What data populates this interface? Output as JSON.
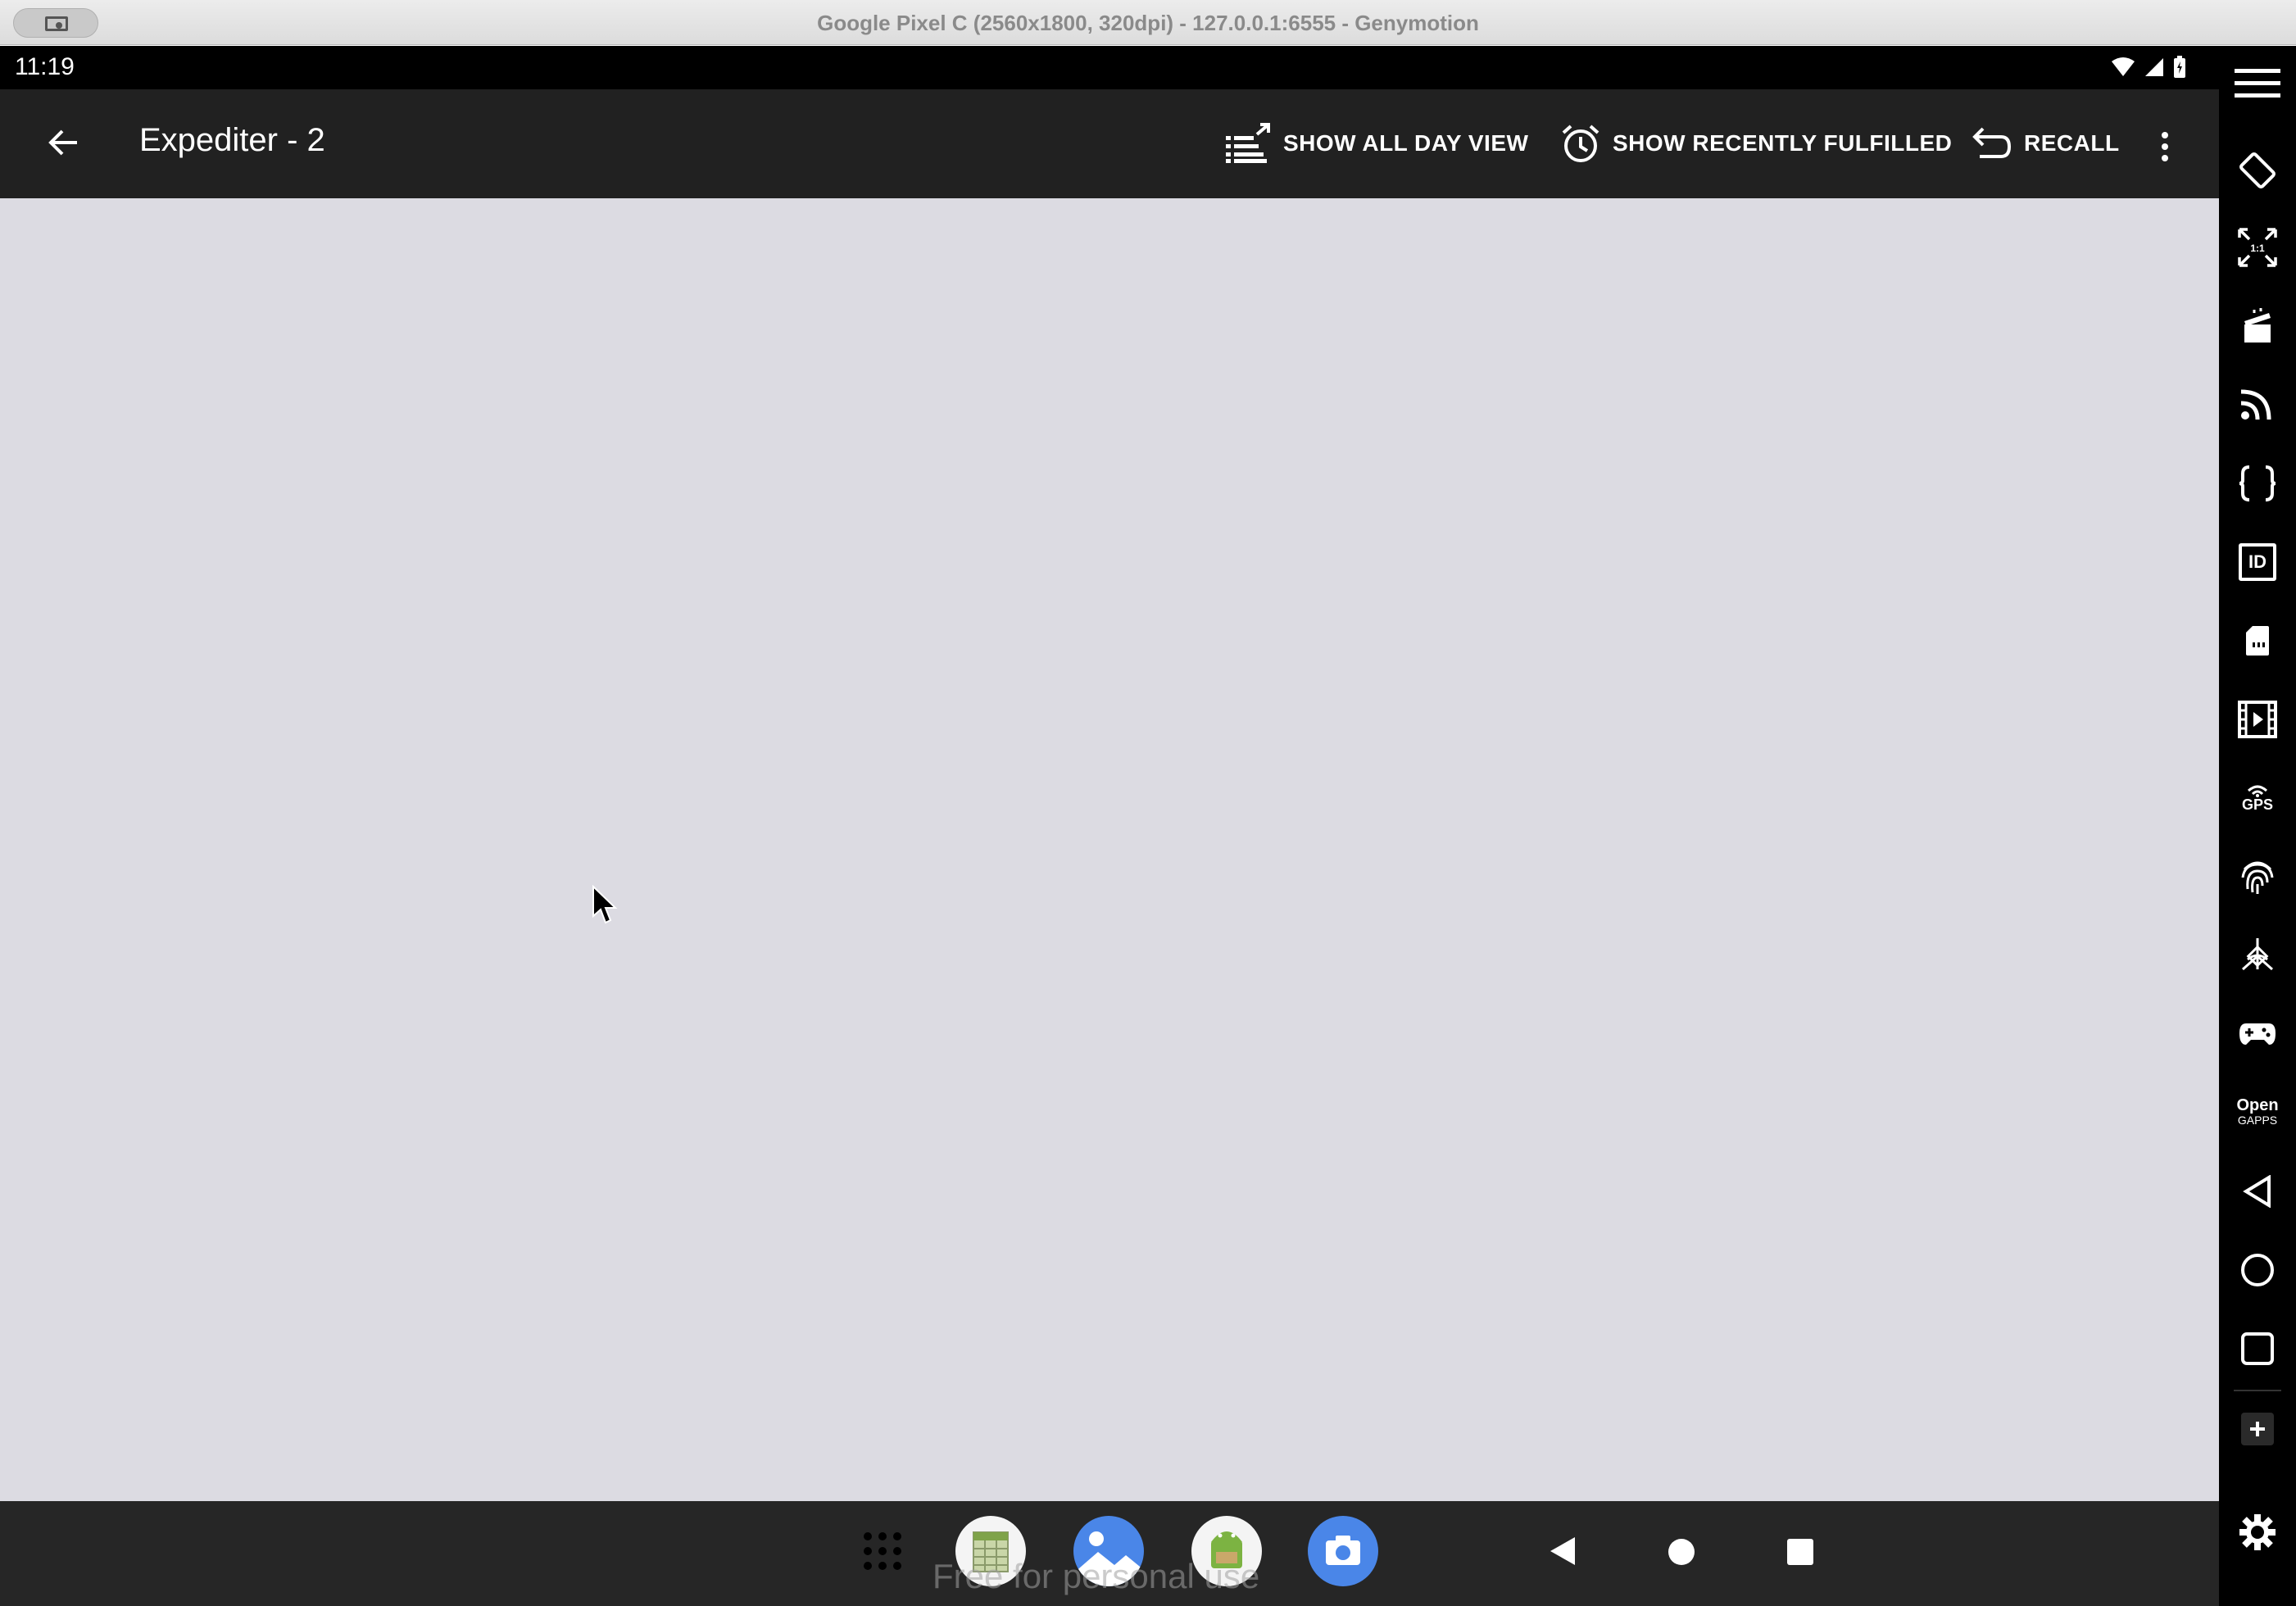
{
  "window": {
    "title": "Google Pixel C (2560x1800, 320dpi) - 127.0.0.1:6555 - Genymotion"
  },
  "status_bar": {
    "time": "11:19",
    "icons": [
      "wifi-icon",
      "signal-icon",
      "battery-icon"
    ]
  },
  "app_bar": {
    "title": "Expediter - 2",
    "actions": [
      {
        "label": "SHOW ALL DAY VIEW",
        "icon": "list-expand-icon"
      },
      {
        "label": "SHOW RECENTLY FULFILLED",
        "icon": "alarm-clock-icon"
      },
      {
        "label": "RECALL",
        "icon": "undo-arrow-icon"
      }
    ],
    "overflow_icon": "more-vert-icon"
  },
  "nav_bar": {
    "watermark": "Free for personal use",
    "dock_apps": [
      "app-drawer-icon",
      "spreadsheet-app-icon",
      "gallery-app-icon",
      "android-app-icon",
      "camera-app-icon"
    ],
    "buttons": [
      "back-icon",
      "home-icon",
      "recents-icon"
    ]
  },
  "toolbar": {
    "items": [
      "menu-icon",
      "rotate-icon",
      "pixel-perfect-icon",
      "capture-icon",
      "cast-icon",
      "api-icon",
      "identifiers-icon",
      "sd-card-icon",
      "media-icon",
      "gps-icon",
      "biometrics-icon",
      "motion-sensor-icon",
      "gamepad-icon",
      "open-gapps-icon",
      "back-icon",
      "home-icon",
      "recents-icon",
      "add-icon",
      "settings-icon"
    ],
    "gps_label": "GPS",
    "gapps_label_1": "Open",
    "gapps_label_2": "GAPPS",
    "id_label": "ID"
  },
  "colors": {
    "app_bar": "#212121",
    "content_bg": "#dcdbe2",
    "nav_bar": "#262626",
    "toolbar": "#000000"
  }
}
